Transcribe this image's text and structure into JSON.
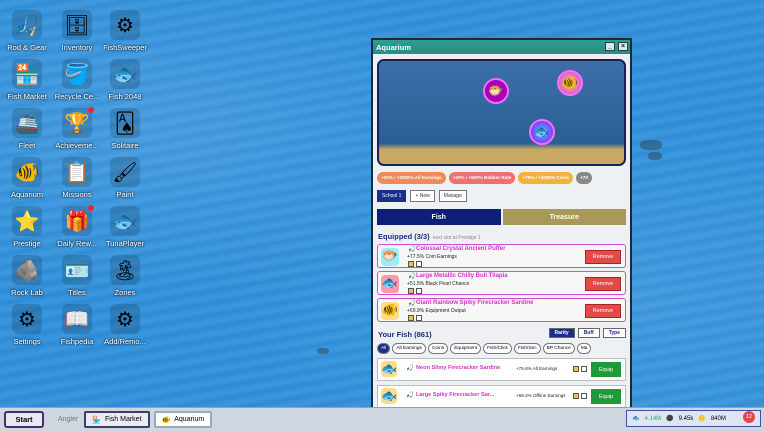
{
  "desktop": {
    "icons": [
      {
        "label": "Rod & Gear",
        "glyph": "🎣"
      },
      {
        "label": "Inventory",
        "glyph": "🗄"
      },
      {
        "label": "FishSweeper",
        "glyph": "⚙"
      },
      {
        "label": "Fish Market",
        "glyph": "🏪"
      },
      {
        "label": "Recycle Ce...",
        "glyph": "🪣"
      },
      {
        "label": "Fish 2048",
        "glyph": "🐟"
      },
      {
        "label": "Fleet",
        "glyph": "🚢"
      },
      {
        "label": "Achieveme...",
        "glyph": "🏆"
      },
      {
        "label": "Solitaire",
        "glyph": "🂡"
      },
      {
        "label": "Aquarium",
        "glyph": "🐠"
      },
      {
        "label": "Missions",
        "glyph": "📋"
      },
      {
        "label": "Paint",
        "glyph": "🖌"
      },
      {
        "label": "Prestige",
        "glyph": "⭐"
      },
      {
        "label": "Daily Rew...",
        "glyph": "🎁"
      },
      {
        "label": "TunaPlayer",
        "glyph": "🐟"
      },
      {
        "label": "Rock Lab",
        "glyph": "🪨"
      },
      {
        "label": "Titles",
        "glyph": "🪪"
      },
      {
        "label": "Zones",
        "glyph": "🏝"
      },
      {
        "label": "Settings",
        "glyph": "⚙"
      },
      {
        "label": "Fishpedia",
        "glyph": "📖"
      },
      {
        "label": "Add/Remo...",
        "glyph": "⚙"
      }
    ]
  },
  "window": {
    "title": "Aquarium",
    "minimize": "_",
    "close": "×",
    "buff_chips": [
      {
        "text": "+20% / +2000% All Earnings",
        "color": "#f08a5a"
      },
      {
        "text": "+20% / +500% Bobber Rate",
        "color": "#f07070"
      },
      {
        "text": "+79% / +2000% Coins",
        "color": "#f2b33d"
      },
      {
        "text": "+70",
        "color": "#888888"
      }
    ],
    "school_label": "School 1",
    "new_label": "+ New",
    "manage_label": "Manage",
    "tab_fish": "Fish",
    "tab_treasure": "Treasure",
    "equipped_title": "Equipped (3/3)",
    "equipped_note": "next slot at Prestige 1",
    "equipped": [
      {
        "name": "Colossal Crystal Ancient Puffer",
        "stat": "+77.5% Coin Earnings",
        "glyph": "🐡",
        "remove": "Remove"
      },
      {
        "name": "Large Metallic Chilly Bull Tilapia",
        "stat": "+51.5% Black Pearl Chance",
        "glyph": "🐟",
        "remove": "Remove"
      },
      {
        "name": "Giant Rainbow Spiky Firecracker Sardine",
        "stat": "+69.9% Equipment Output",
        "glyph": "🐠",
        "remove": "Remove"
      }
    ],
    "your_fish_title": "Your Fish (861)",
    "sort": [
      "Rarity",
      "Buff",
      "Type"
    ],
    "filters": [
      "All",
      "All Earnings",
      "Coins",
      "Equipment",
      "Fish/Click",
      "Fish/Sec",
      "BP Chance",
      "Ma"
    ],
    "list": [
      {
        "name": "Neon Slimy Firecracker Sardine",
        "stat": "+75.6% All Earnings",
        "glyph": "🐟",
        "action": "Equip"
      },
      {
        "name": "Large Spiky Firecracker Sar...",
        "stat": "+69.4% Offline Earnings",
        "glyph": "🐟",
        "action": "Equip"
      }
    ]
  },
  "taskbar": {
    "start": "Start",
    "label": "Angler",
    "tasks": [
      "Fish Market",
      "Aquarium"
    ],
    "tray": {
      "fish": "4.14M",
      "pearls": "9.45k",
      "coins": "840M",
      "notif": "12"
    }
  }
}
